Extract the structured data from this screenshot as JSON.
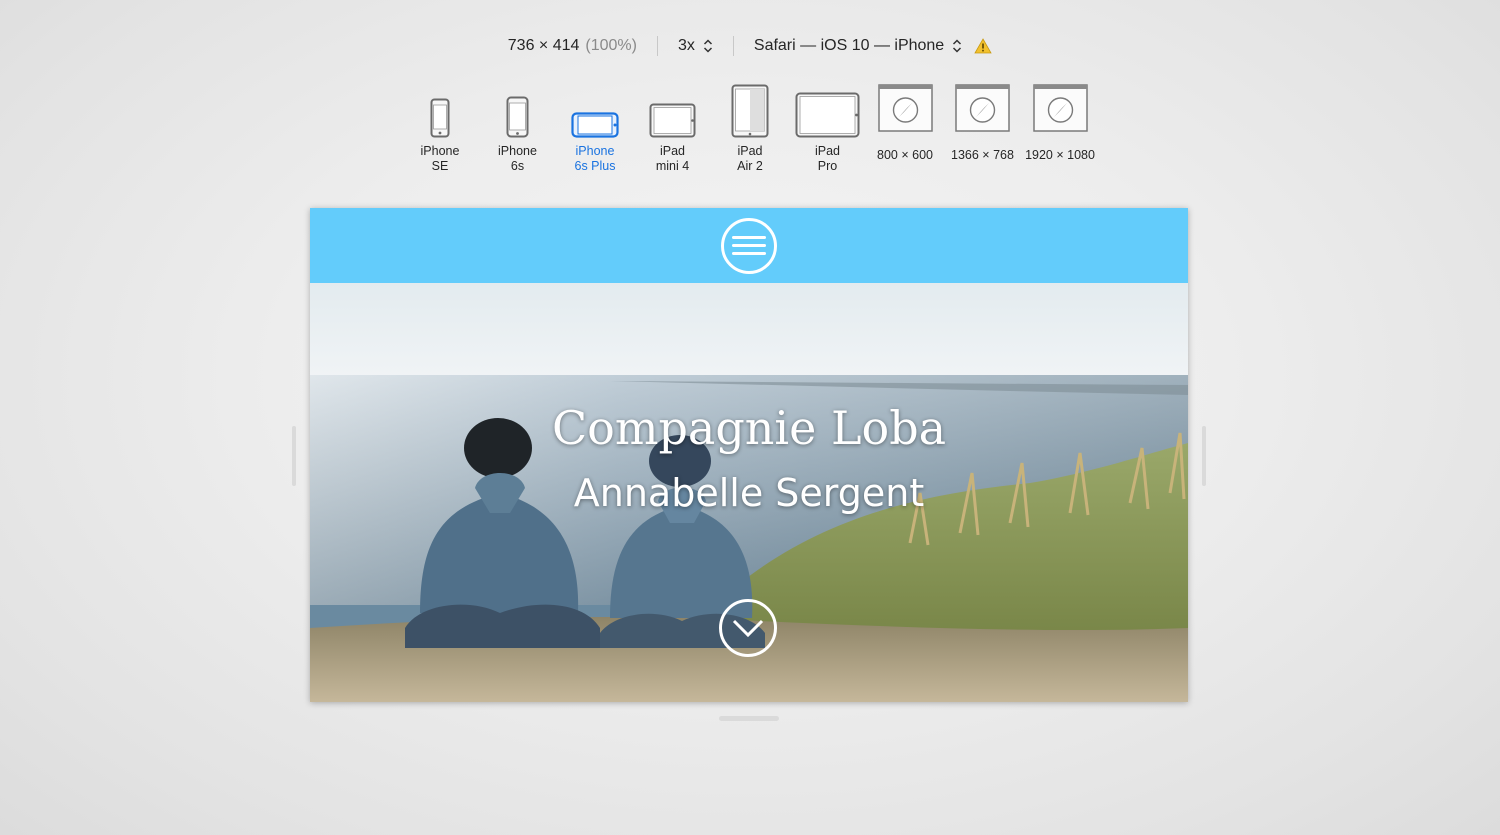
{
  "toolbar": {
    "resolution": "736 × 414",
    "zoom": "(100%)",
    "scale": "3x",
    "user_agent": "Safari — iOS 10 — iPhone",
    "icons": [
      "updown-chevron-icon",
      "warning-icon"
    ],
    "warning_color": "#f2c12e"
  },
  "devices": [
    {
      "label": "iPhone\nSE",
      "icon": "phone-portrait-icon"
    },
    {
      "label": "iPhone\n6s",
      "icon": "phone-portrait-icon"
    },
    {
      "label": "iPhone\n6s Plus",
      "icon": "phone-landscape-icon",
      "selected": true
    },
    {
      "label": "iPad\nmini 4",
      "icon": "tablet-landscape-icon"
    },
    {
      "label": "iPad\nAir 2",
      "icon": "tablet-portrait-icon"
    },
    {
      "label": "iPad\nPro",
      "icon": "tablet-landscape-icon"
    },
    {
      "label": "800 × 600",
      "icon": "safari-window-icon"
    },
    {
      "label": "1366 × 768",
      "icon": "safari-window-icon"
    },
    {
      "label": "1920 × 1080",
      "icon": "safari-window-icon"
    }
  ],
  "site": {
    "header_color": "#63ccfb",
    "title": "Compagnie Loba",
    "subtitle": "Annabelle Sergent",
    "icons": [
      "hamburger-menu-icon",
      "scroll-down-chevron-icon"
    ]
  },
  "colors": {
    "accent_selected": "#1a73e0"
  }
}
